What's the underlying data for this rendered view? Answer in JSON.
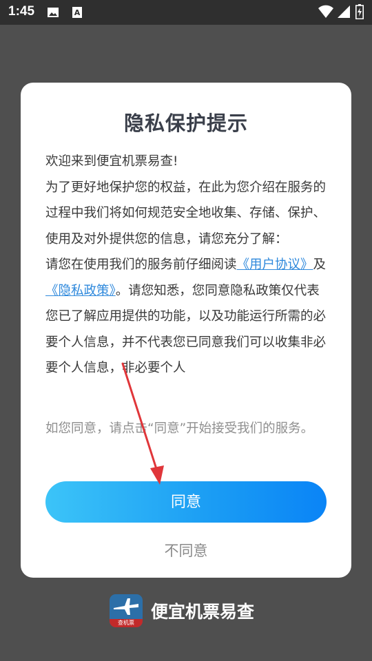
{
  "status_bar": {
    "time": "1:45",
    "left_icons": [
      "image-icon",
      "text-a-icon"
    ],
    "right_icons": [
      "wifi-icon",
      "signal-icon",
      "battery-icon"
    ]
  },
  "dialog": {
    "title": "隐私保护提示",
    "greeting": "欢迎来到便宜机票易查!",
    "para1": "为了更好地保护您的权益，在此为您介绍在服务的过程中我们将如何规范安全地收集、存储、保护、使用及对外提供您的信息，请您充分了解：",
    "para2_prefix": "请您在使用我们的服务前仔细阅读",
    "user_agreement_link": "《用户协议》",
    "and_text": "及",
    "privacy_policy_link": "《隐私政策》",
    "para2_suffix": "。请您知悉，您同意隐私政策仅代表您已了解应用提供的功能，以及功能运行所需的必要个人信息，并不代表您已同意我们可以收集非必要个人信息，非必要个人",
    "consent_text": "如您同意，请点击“同意”开始接受我们的服务。",
    "agree_label": "同意",
    "disagree_label": "不同意"
  },
  "brand": {
    "name": "便宜机票易查",
    "logo_caption": "查机票"
  },
  "colors": {
    "link": "#2f89dc",
    "button_start": "#3cc4f8",
    "button_end": "#0a84f6",
    "arrow": "#e0363a"
  }
}
